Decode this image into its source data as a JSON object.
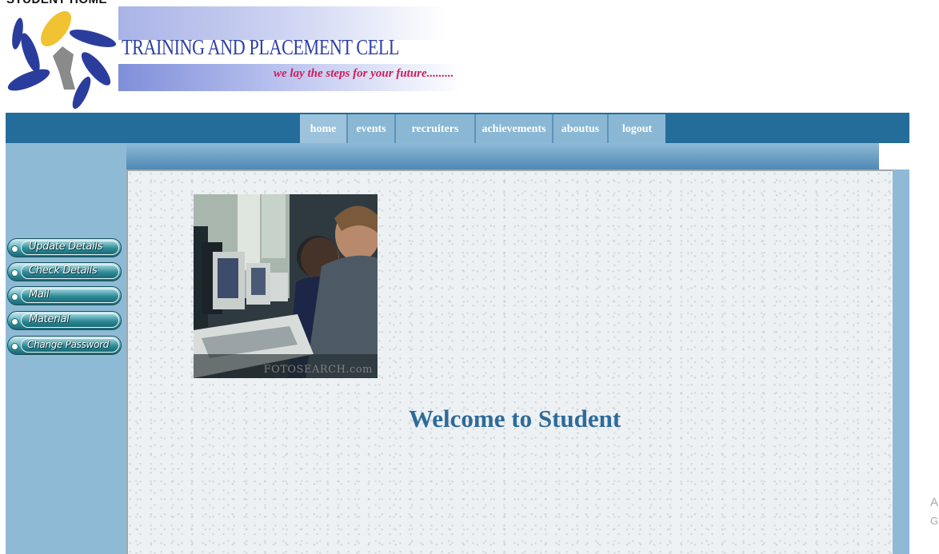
{
  "page": {
    "caption": "STUDENT HOME"
  },
  "header": {
    "title": "TRAINING AND PLACEMENT CELL",
    "tagline": "we lay the steps for your future........."
  },
  "nav": [
    {
      "label": "home"
    },
    {
      "label": "events"
    },
    {
      "label": "recruiters"
    },
    {
      "label": "achievements"
    },
    {
      "label": "aboutus"
    },
    {
      "label": "logout"
    }
  ],
  "sidebar": {
    "buttons": [
      {
        "label": "Update Details"
      },
      {
        "label": "Check Details"
      },
      {
        "label": "Mail"
      },
      {
        "label": "Material"
      },
      {
        "label": "Change Password"
      }
    ]
  },
  "main": {
    "photo_credit": "FOTOSEARCH.com",
    "welcome": "Welcome to Student"
  },
  "overlay": {
    "line1": "A",
    "line2": "G"
  },
  "colors": {
    "navbar": "#246d9b",
    "nav_tab": "#8ab7d3",
    "sidebar": "#8fbad6",
    "welcome_text": "#2d6b9a",
    "title_text": "#2d3fa6",
    "tagline_text": "#d01c5b"
  }
}
